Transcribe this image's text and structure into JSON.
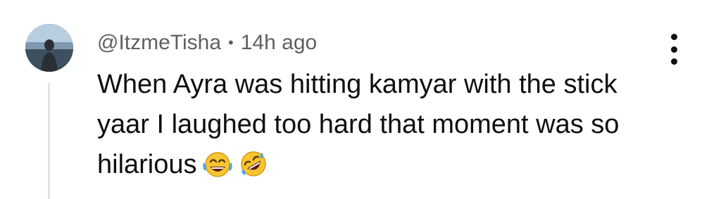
{
  "comment": {
    "author": "@ItzmeTisha",
    "separator": "•",
    "time": "14h ago",
    "text_line1": "When Ayra was hitting kamyar with the stick",
    "text_line2": "yaar I laughed too hard that moment was so",
    "text_line3": "hilarious",
    "emojis": [
      "face-with-tears-of-joy",
      "rolling-on-the-floor-laughing"
    ]
  },
  "icons": {
    "more": "more-vertical-icon",
    "avatar": "profile-photo"
  },
  "colors": {
    "meta_text": "#606060",
    "body_text": "#0f0f0f",
    "thread_line": "#e3e3e3",
    "emoji_yellow": "#f7c531"
  }
}
